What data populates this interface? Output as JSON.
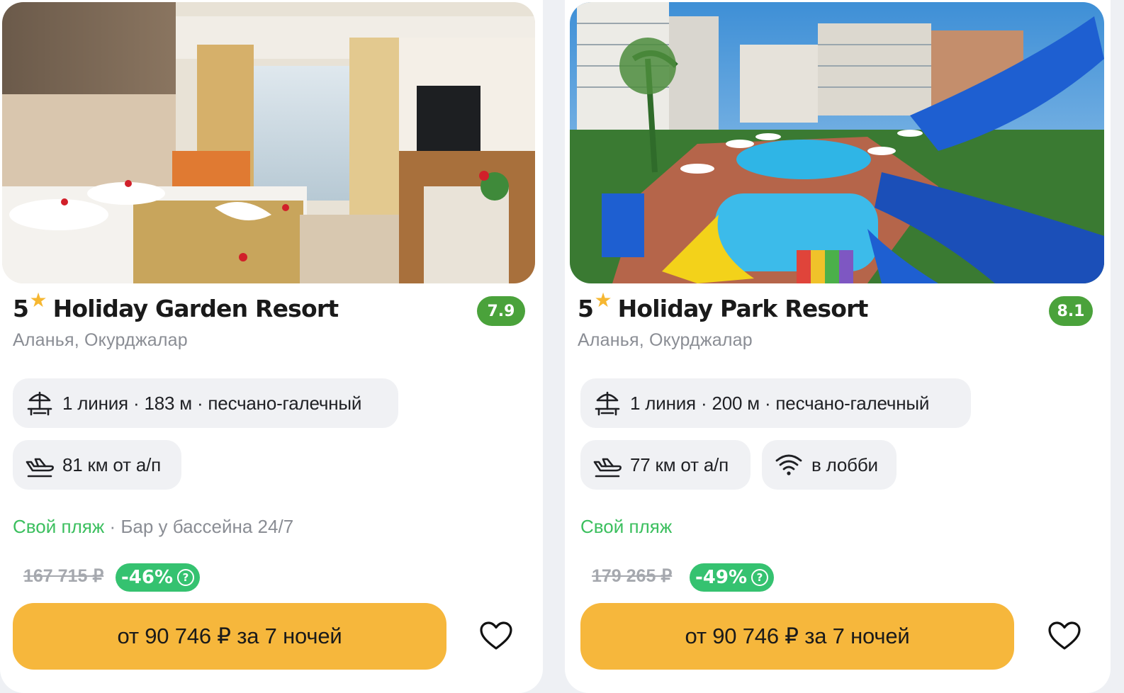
{
  "cards": [
    {
      "stars": "5",
      "name": "Holiday Garden Resort",
      "rating": "7.9",
      "location": "Аланья, Окурджалар",
      "beach_chip": "1 линия · 183 м · песчано-галечный",
      "airport_chip": "81 км от а/п",
      "feature_highlight": "Свой пляж",
      "feature_sep": " · ",
      "feature_other": "Бар у бассейна 24/7",
      "old_price": "167 715 ₽",
      "discount": "-46%",
      "discount_info": "?",
      "cta": "от 90 746 ₽ за 7 ночей"
    },
    {
      "stars": "5",
      "name": "Holiday Park Resort",
      "rating": "8.1",
      "location": "Аланья, Окурджалар",
      "beach_chip": "1 линия · 200 м · песчано-галечный",
      "airport_chip": "77 км от а/п",
      "wifi_chip": "в лобби",
      "feature_highlight": "Свой пляж",
      "old_price": "179 265 ₽",
      "discount": "-49%",
      "discount_info": "?",
      "cta": "от 90 746 ₽ за 7 ночей"
    }
  ],
  "icons": {
    "star": "star-icon",
    "beach": "beach-umbrella-icon",
    "airport": "plane-landing-icon",
    "wifi": "wifi-icon",
    "favorite": "heart-icon"
  },
  "colors": {
    "cta": "#f6b73c",
    "rating": "#4aa23b",
    "discount": "#35c270",
    "highlight": "#3bbf5e",
    "star": "#f6b731"
  }
}
